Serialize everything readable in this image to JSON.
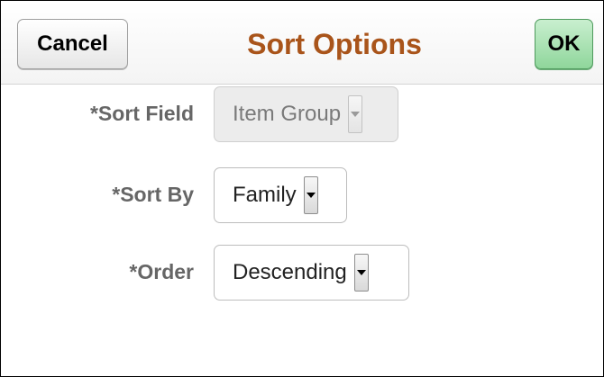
{
  "dialog": {
    "title": "Sort Options",
    "cancel_label": "Cancel",
    "ok_label": "OK"
  },
  "fields": [
    {
      "label": "*Sort Field",
      "value": "Item Group",
      "disabled": true
    },
    {
      "label": "*Sort By",
      "value": "Family",
      "disabled": false
    },
    {
      "label": "*Order",
      "value": "Descending",
      "disabled": false
    }
  ],
  "colors": {
    "title": "#a9541a",
    "ok_button": "#8fd69b",
    "label": "#666666"
  },
  "icons": [
    "chevron-down-icon"
  ]
}
